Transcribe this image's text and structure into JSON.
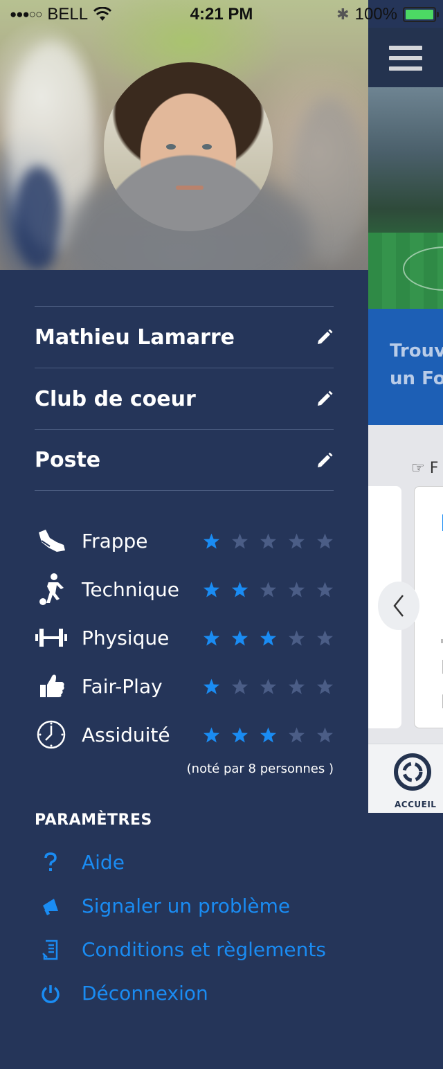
{
  "status_bar": {
    "signal": "●●●○○",
    "carrier": "BELL",
    "time": "4:21 PM",
    "battery": "100%",
    "battery_color": "#4cd964"
  },
  "profile": {
    "fields": [
      {
        "label": "Mathieu Lamarre",
        "icon": "pencil-icon"
      },
      {
        "label": "Club de coeur",
        "icon": "pencil-icon"
      },
      {
        "label": "Poste",
        "icon": "pencil-icon"
      }
    ]
  },
  "ratings": {
    "items": [
      {
        "label": "Frappe",
        "icon": "football-boot-icon",
        "stars": 1,
        "max": 5
      },
      {
        "label": "Technique",
        "icon": "player-kick-icon",
        "stars": 2,
        "max": 5
      },
      {
        "label": "Physique",
        "icon": "dumbbell-icon",
        "stars": 3,
        "max": 5
      },
      {
        "label": "Fair-Play",
        "icon": "thumbs-up-icon",
        "stars": 1,
        "max": 5
      },
      {
        "label": "Assiduité",
        "icon": "clock-icon",
        "stars": 3,
        "max": 5
      }
    ],
    "rated_by": "(noté par 8 personnes )",
    "star_active_color": "#1a8cf3",
    "star_inactive_color": "#4b5d86"
  },
  "settings": {
    "title": "PARAMÈTRES",
    "items": [
      {
        "label": "Aide",
        "icon": "question-icon"
      },
      {
        "label": "Signaler un problème",
        "icon": "megaphone-icon"
      },
      {
        "label": "Conditions et règlements",
        "icon": "document-icon"
      },
      {
        "label": "Déconnexion",
        "icon": "power-icon"
      }
    ],
    "accent_color": "#1a8cf3"
  },
  "background": {
    "promo_line1": "Trouv",
    "promo_line2": "un Fo",
    "find_text": "F",
    "tab_label": "ACCUEIL"
  },
  "colors": {
    "drawer_bg": "#253559",
    "divider": "#4b5c80"
  }
}
